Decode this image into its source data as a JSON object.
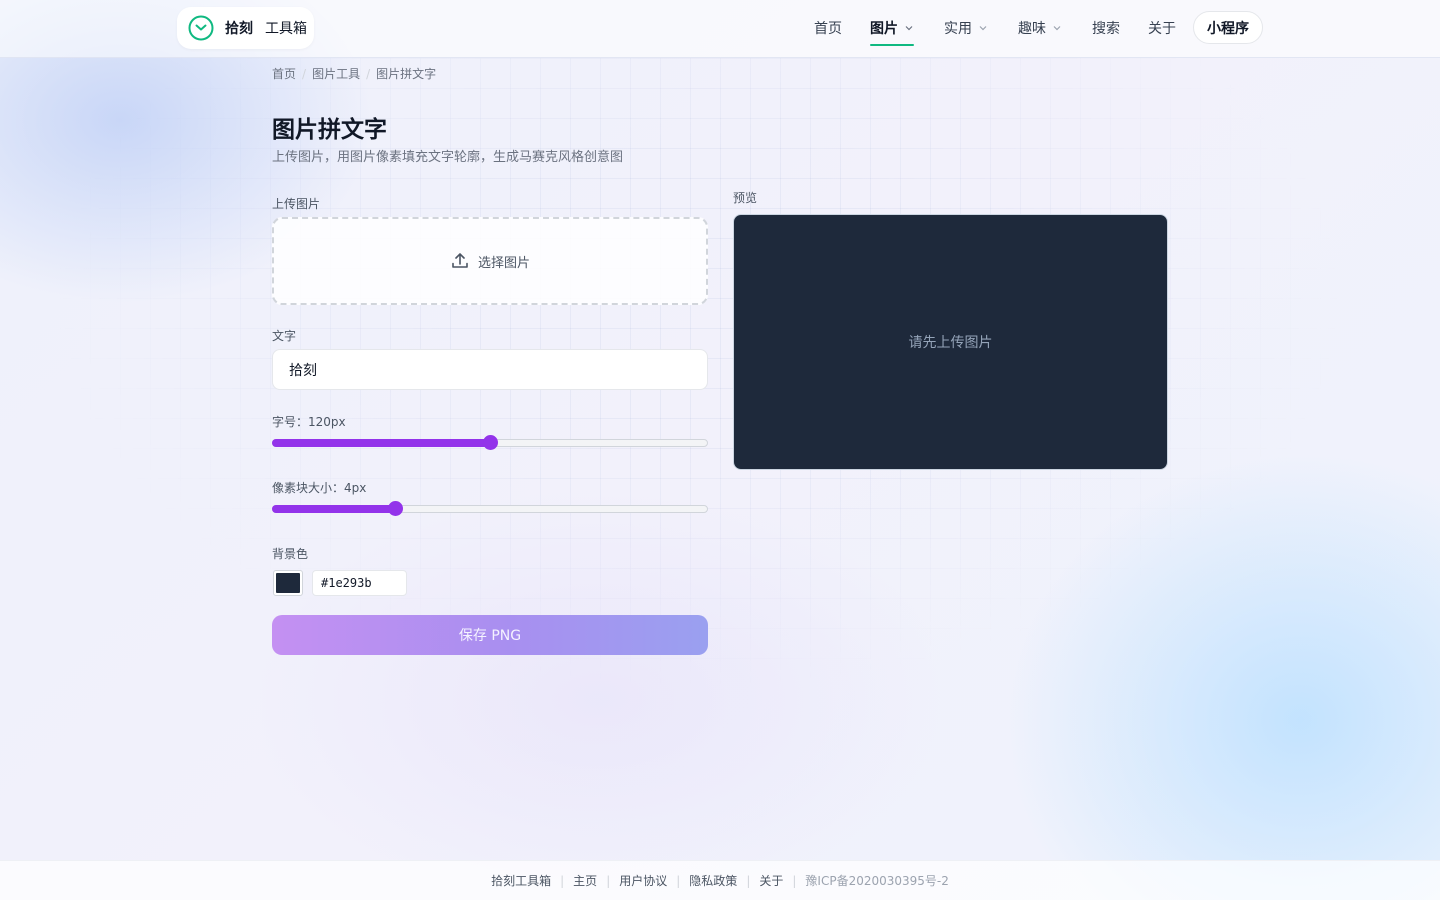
{
  "brand": {
    "name": "拾刻",
    "sub": "工具箱",
    "accent": "#10b981"
  },
  "nav": {
    "items": [
      {
        "label": "首页",
        "dropdown": false,
        "active": false
      },
      {
        "label": "图片",
        "dropdown": true,
        "active": true
      },
      {
        "label": "实用",
        "dropdown": true,
        "active": false
      },
      {
        "label": "趣味",
        "dropdown": true,
        "active": false
      },
      {
        "label": "搜索",
        "dropdown": false,
        "active": false
      },
      {
        "label": "关于",
        "dropdown": false,
        "active": false
      }
    ],
    "mini_program": "小程序"
  },
  "breadcrumb": [
    "首页",
    "图片工具",
    "图片拼文字"
  ],
  "page": {
    "title": "图片拼文字",
    "description": "上传图片，用图片像素填充文字轮廓，生成马赛克风格创意图"
  },
  "form": {
    "upload_label": "上传图片",
    "upload_button": "选择图片",
    "text_label": "文字",
    "text_value": "拾刻",
    "font_size": {
      "label": "字号：120px",
      "value": 120,
      "min": 20,
      "max": 220,
      "fraction": 0.5
    },
    "pixel_size": {
      "label": "像素块大小：4px",
      "value": 4,
      "min": 1,
      "max": 12,
      "fraction": 0.283
    },
    "bg_label": "背景色",
    "bg_color": "#1e293b",
    "save_button": "保存 PNG",
    "accent": "#9333ea"
  },
  "preview": {
    "label": "预览",
    "placeholder": "请先上传图片",
    "background": "#1e293b"
  },
  "footer": {
    "links": [
      "拾刻工具箱",
      "主页",
      "用户协议",
      "隐私政策",
      "关于"
    ],
    "icp": "豫ICP备2020030395号-2"
  }
}
